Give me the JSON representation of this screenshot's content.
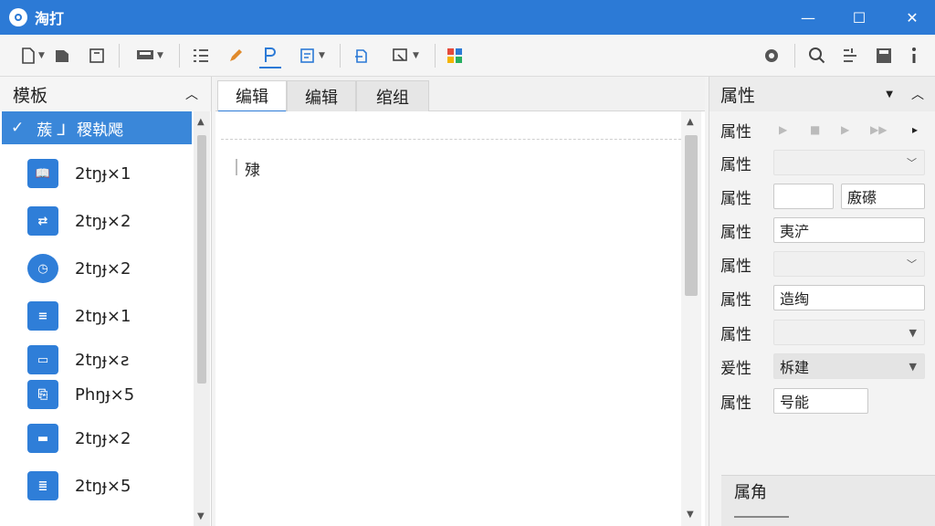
{
  "app": {
    "title": "淘打"
  },
  "window_controls": {
    "minimize": "—",
    "maximize": "☐",
    "close": "✕"
  },
  "toolbar": {
    "icons": [
      "new-file-icon",
      "open-file-icon",
      "page-icon",
      "print-icon",
      "list-icon",
      "pen-icon",
      "paragraph-icon",
      "format-icon",
      "export-icon",
      "image-icon",
      "color-grid-icon",
      "settings-icon",
      "search-icon",
      "tools-icon",
      "save-icon",
      "more-icon"
    ]
  },
  "left_panel": {
    "title": "模板",
    "selected_label_a": "蔟 ⅃",
    "selected_label_b": "稷執飔",
    "templates": [
      {
        "label": "2tŋɟ×1",
        "icon": "book-icon",
        "color": "#2f7ed8"
      },
      {
        "label": "2tŋɟ×2",
        "icon": "card-icon",
        "color": "#2f7ed8"
      },
      {
        "label": "2tŋɟ×2",
        "icon": "clock-icon",
        "color": "#2f7ed8"
      },
      {
        "label": "2tŋɟ×1",
        "icon": "note-icon",
        "color": "#2f7ed8"
      },
      {
        "label": "2tŋɟ×ƨ",
        "icon": "folders-icon",
        "color": "#2f7ed8"
      },
      {
        "label": "Phŋɟ×5",
        "icon": "document-icon",
        "color": "#2f7ed8"
      },
      {
        "label": "2tŋɟ×2",
        "icon": "monitor-icon",
        "color": "#2f7ed8"
      },
      {
        "label": "2tŋɟ×5",
        "icon": "file-text-icon",
        "color": "#2f7ed8"
      }
    ]
  },
  "tabs": [
    {
      "label": "编辑",
      "active": true
    },
    {
      "label": "编辑",
      "active": false
    },
    {
      "label": "绾组",
      "active": false
    }
  ],
  "editor": {
    "content": "殔"
  },
  "right_panel": {
    "title": "属性",
    "rows": [
      {
        "label": "属性",
        "value": ""
      },
      {
        "label": "属性",
        "value": ""
      },
      {
        "label": "属性",
        "value": "",
        "value2": "廒礤"
      },
      {
        "label": "属性",
        "value": "夷浐"
      },
      {
        "label": "属性",
        "value": ""
      },
      {
        "label": "属性",
        "value": "造绹"
      },
      {
        "label": "属性",
        "value": ""
      },
      {
        "label": "爰性",
        "value": "柝建"
      },
      {
        "label": "属性",
        "value": "号能"
      }
    ],
    "sub_panel_title": "属角"
  },
  "colors": {
    "titlebar": "#2c7ad6",
    "selection": "#3a87d9",
    "accent": "#2c7ad6"
  }
}
